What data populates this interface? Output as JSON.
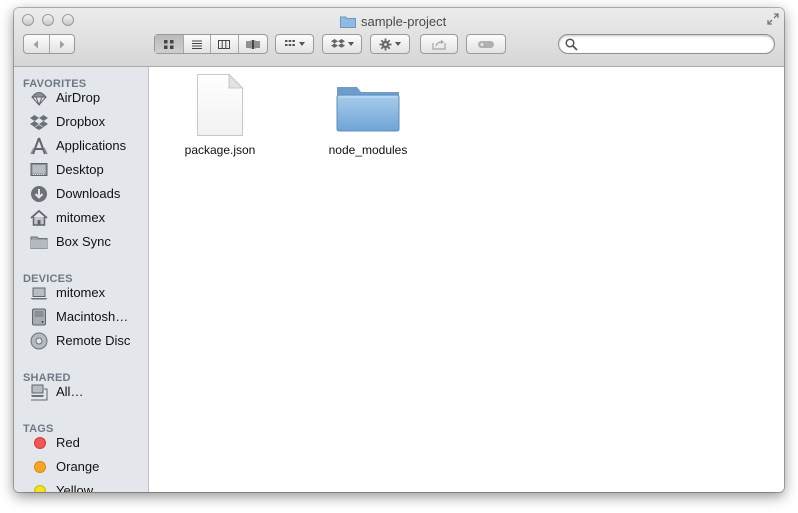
{
  "window": {
    "title": "sample-project"
  },
  "sidebar": {
    "favorites_title": "FAVORITES",
    "favorites": [
      {
        "label": "AirDrop",
        "icon": "airdrop-icon"
      },
      {
        "label": "Dropbox",
        "icon": "dropbox-icon"
      },
      {
        "label": "Applications",
        "icon": "applications-icon"
      },
      {
        "label": "Desktop",
        "icon": "desktop-icon"
      },
      {
        "label": "Downloads",
        "icon": "downloads-icon"
      },
      {
        "label": "mitomex",
        "icon": "home-icon"
      },
      {
        "label": "Box Sync",
        "icon": "folder-icon"
      }
    ],
    "devices_title": "DEVICES",
    "devices": [
      {
        "label": "mitomex",
        "icon": "laptop-icon"
      },
      {
        "label": "Macintosh…",
        "icon": "hard-drive-icon"
      },
      {
        "label": "Remote Disc",
        "icon": "disc-icon"
      }
    ],
    "shared_title": "SHARED",
    "shared": [
      {
        "label": "All…",
        "icon": "network-computer-icon"
      }
    ],
    "tags_title": "TAGS",
    "tags": [
      {
        "label": "Red",
        "color": "#f25656"
      },
      {
        "label": "Orange",
        "color": "#f7a523"
      },
      {
        "label": "Yellow",
        "color": "#f2e21f"
      }
    ]
  },
  "files": [
    {
      "name": "package.json",
      "icon": "document-icon"
    },
    {
      "name": "node_modules",
      "icon": "folder-icon"
    }
  ],
  "colors": {
    "sidebar_bg": "#e3e7ec",
    "folder_blue": "#7fb1dc"
  }
}
